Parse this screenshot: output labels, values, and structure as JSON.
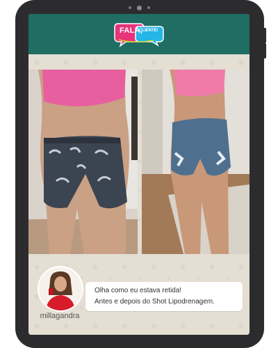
{
  "header": {
    "logo_main": "FALA,",
    "logo_sub": "CLIENTE!",
    "background": "#1f6d63"
  },
  "photos": [
    {
      "name": "before"
    },
    {
      "name": "after"
    }
  ],
  "message": {
    "line1": "Olha como eu estava retida!",
    "line2": "Antes e depois do Shot Lipodrenagem.",
    "username": "millagandra"
  },
  "colors": {
    "logo_pink": "#e8327a",
    "logo_cyan": "#25b5e6",
    "header_green": "#1f6d63",
    "tablet_frame": "#2c2c2e"
  }
}
